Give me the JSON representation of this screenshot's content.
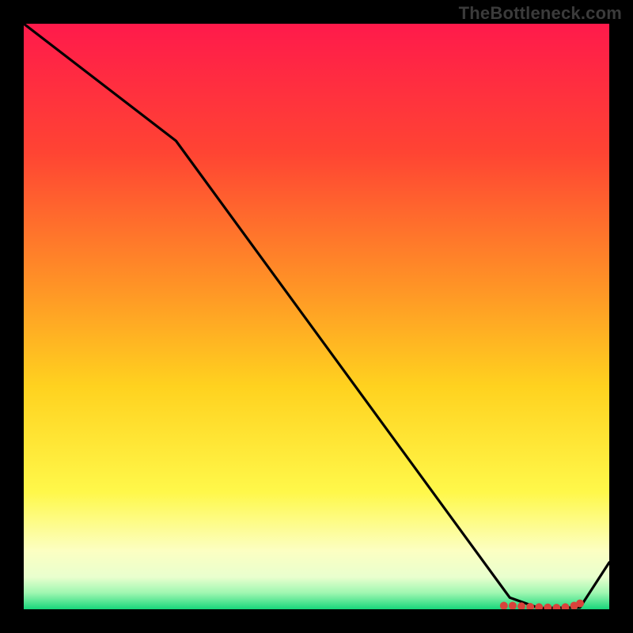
{
  "watermark": "TheBottleneck.com",
  "chart_data": {
    "type": "line",
    "title": "",
    "xlabel": "",
    "ylabel": "",
    "xlim": [
      0,
      100
    ],
    "ylim": [
      0,
      100
    ],
    "grid": false,
    "legend": null,
    "series": [
      {
        "name": "curve",
        "x": [
          0,
          26,
          83,
          88,
          95,
          100
        ],
        "y": [
          100,
          80,
          2,
          0.2,
          0.3,
          8
        ]
      }
    ],
    "markers": {
      "name": "cluster",
      "color": "#d9433b",
      "points": [
        {
          "x": 82,
          "y": 0.6
        },
        {
          "x": 83.5,
          "y": 0.6
        },
        {
          "x": 85,
          "y": 0.5
        },
        {
          "x": 86.5,
          "y": 0.4
        },
        {
          "x": 88,
          "y": 0.35
        },
        {
          "x": 89.5,
          "y": 0.3
        },
        {
          "x": 91,
          "y": 0.25
        },
        {
          "x": 92.5,
          "y": 0.35
        },
        {
          "x": 94,
          "y": 0.6
        },
        {
          "x": 95,
          "y": 1.0
        }
      ]
    },
    "gradient_stops": [
      {
        "offset": 0.0,
        "color": "#ff1a4b"
      },
      {
        "offset": 0.22,
        "color": "#ff4433"
      },
      {
        "offset": 0.45,
        "color": "#ff9426"
      },
      {
        "offset": 0.62,
        "color": "#ffd21f"
      },
      {
        "offset": 0.8,
        "color": "#fff84a"
      },
      {
        "offset": 0.9,
        "color": "#fcffc2"
      },
      {
        "offset": 0.945,
        "color": "#e9ffce"
      },
      {
        "offset": 0.972,
        "color": "#9ff7b1"
      },
      {
        "offset": 1.0,
        "color": "#17d67a"
      }
    ]
  }
}
